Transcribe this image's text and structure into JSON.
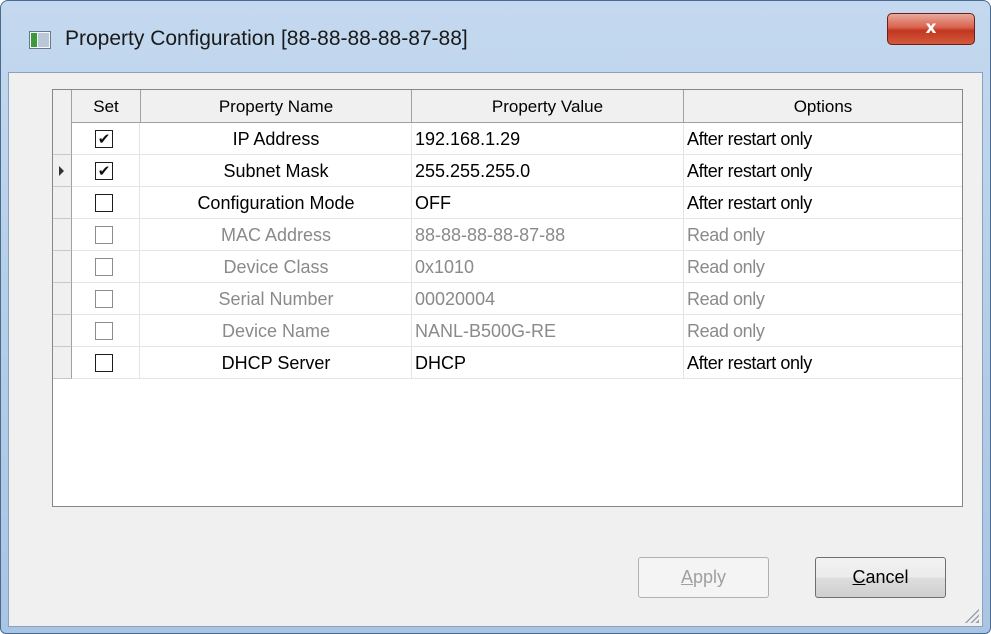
{
  "window": {
    "title": "Property Configuration [88-88-88-88-87-88]",
    "close_glyph": "x"
  },
  "grid": {
    "headers": {
      "set": "Set",
      "name": "Property Name",
      "value": "Property Value",
      "options": "Options"
    },
    "rows": [
      {
        "checked": true,
        "check": "✔",
        "name": "IP Address",
        "value": "192.168.1.29",
        "options": "After restart only",
        "enabled": true
      },
      {
        "checked": true,
        "check": "✔",
        "name": "Subnet Mask",
        "value": "255.255.255.0",
        "options": "After restart only",
        "enabled": true,
        "current": true
      },
      {
        "checked": false,
        "check": "",
        "name": "Configuration Mode",
        "value": "OFF",
        "options": "After restart only",
        "enabled": true
      },
      {
        "checked": false,
        "check": "",
        "name": "MAC Address",
        "value": "88-88-88-88-87-88",
        "options": "Read only",
        "enabled": false
      },
      {
        "checked": false,
        "check": "",
        "name": "Device Class",
        "value": "0x1010",
        "options": "Read only",
        "enabled": false
      },
      {
        "checked": false,
        "check": "",
        "name": "Serial Number",
        "value": "00020004",
        "options": "Read only",
        "enabled": false
      },
      {
        "checked": false,
        "check": "",
        "name": "Device Name",
        "value": "NANL-B500G-RE",
        "options": "Read only",
        "enabled": false
      },
      {
        "checked": false,
        "check": "",
        "name": "DHCP Server",
        "value": "DHCP",
        "options": "After restart only",
        "enabled": true
      }
    ]
  },
  "buttons": {
    "apply": {
      "label": "Apply",
      "mnemonic": "A",
      "rest": "pply",
      "enabled": false
    },
    "cancel": {
      "label": "Cancel",
      "mnemonic": "C",
      "rest": "ancel",
      "enabled": true
    }
  },
  "icons": {
    "window": "app-window-icon",
    "close": "close-icon",
    "row_marker": "current-row-arrow-icon",
    "grip": "resize-grip-icon"
  }
}
